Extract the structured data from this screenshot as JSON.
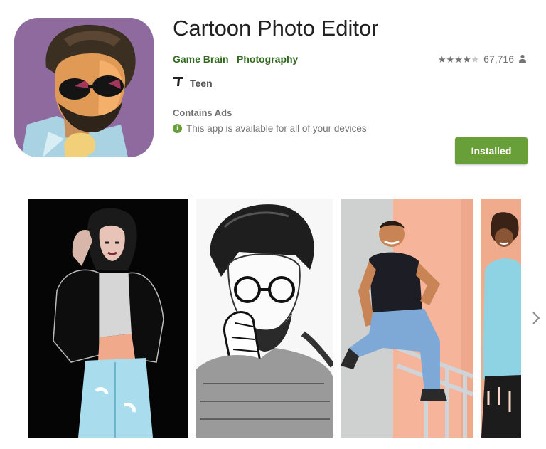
{
  "app": {
    "title": "Cartoon Photo Editor",
    "developer": "Game Brain",
    "category": "Photography",
    "rating_count": "67,716",
    "stars": 4,
    "content_rating": "Teen",
    "ads_label": "Contains Ads",
    "availability": "This app is available for all of your devices",
    "install_button": "Installed"
  },
  "colors": {
    "accent": "#689f38",
    "link": "#33691e",
    "text_secondary": "#737373"
  },
  "icons": [
    "person-icon",
    "teen-rating-icon",
    "info-icon",
    "chevron-right-icon"
  ],
  "screenshots": [
    {
      "name": "screenshot-woman-leather-jacket"
    },
    {
      "name": "screenshot-man-sketch"
    },
    {
      "name": "screenshot-man-sitting-railing"
    },
    {
      "name": "screenshot-woman-curly-hair"
    }
  ]
}
